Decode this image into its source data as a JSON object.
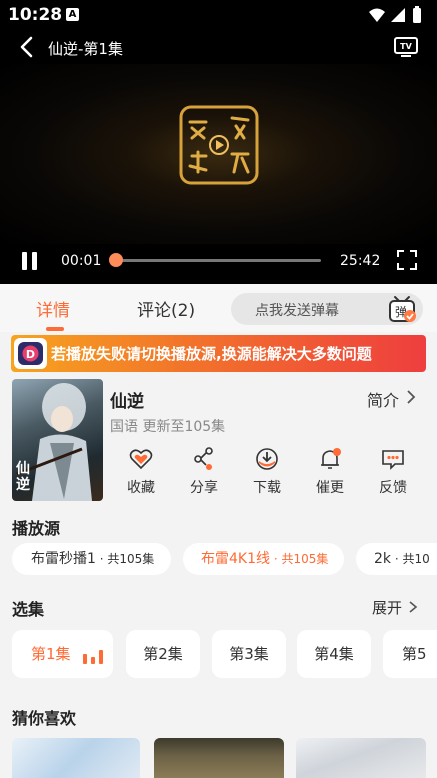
{
  "status_bar": {
    "time": "10:28",
    "notification_letter": "A"
  },
  "player": {
    "title": "仙逆-第1集",
    "current_time": "00:01",
    "total_time": "25:42",
    "progress": 0.0007,
    "accent_color": "#ff6b35"
  },
  "tabs": {
    "detail": "详情",
    "comments": "评论(2)",
    "danmu_placeholder": "点我发送弹幕",
    "danmu_icon_text": "弹"
  },
  "banner": {
    "text": "若播放失败请切换播放源,换源能解决大多数问题",
    "logo_letter": "D"
  },
  "show": {
    "title": "仙逆",
    "subtitle": "国语 更新至105集",
    "intro_label": "简介",
    "poster_caption": "仙逆"
  },
  "actions": [
    {
      "label": "收藏",
      "icon": "heart-icon"
    },
    {
      "label": "分享",
      "icon": "share-icon"
    },
    {
      "label": "下载",
      "icon": "download-icon"
    },
    {
      "label": "催更",
      "icon": "bell-icon"
    },
    {
      "label": "反馈",
      "icon": "feedback-icon"
    }
  ],
  "sources": {
    "title": "播放源",
    "items": [
      {
        "name": "布雷秒播1",
        "count": "共105集",
        "active": false
      },
      {
        "name": "布雷4K1线",
        "count": "共105集",
        "active": true
      },
      {
        "name": "2k",
        "count": "共10",
        "active": false
      }
    ]
  },
  "episodes": {
    "title": "选集",
    "expand_label": "展开",
    "items": [
      "第1集",
      "第2集",
      "第3集",
      "第4集",
      "第5"
    ]
  },
  "recommend": {
    "title": "猜你喜欢"
  }
}
